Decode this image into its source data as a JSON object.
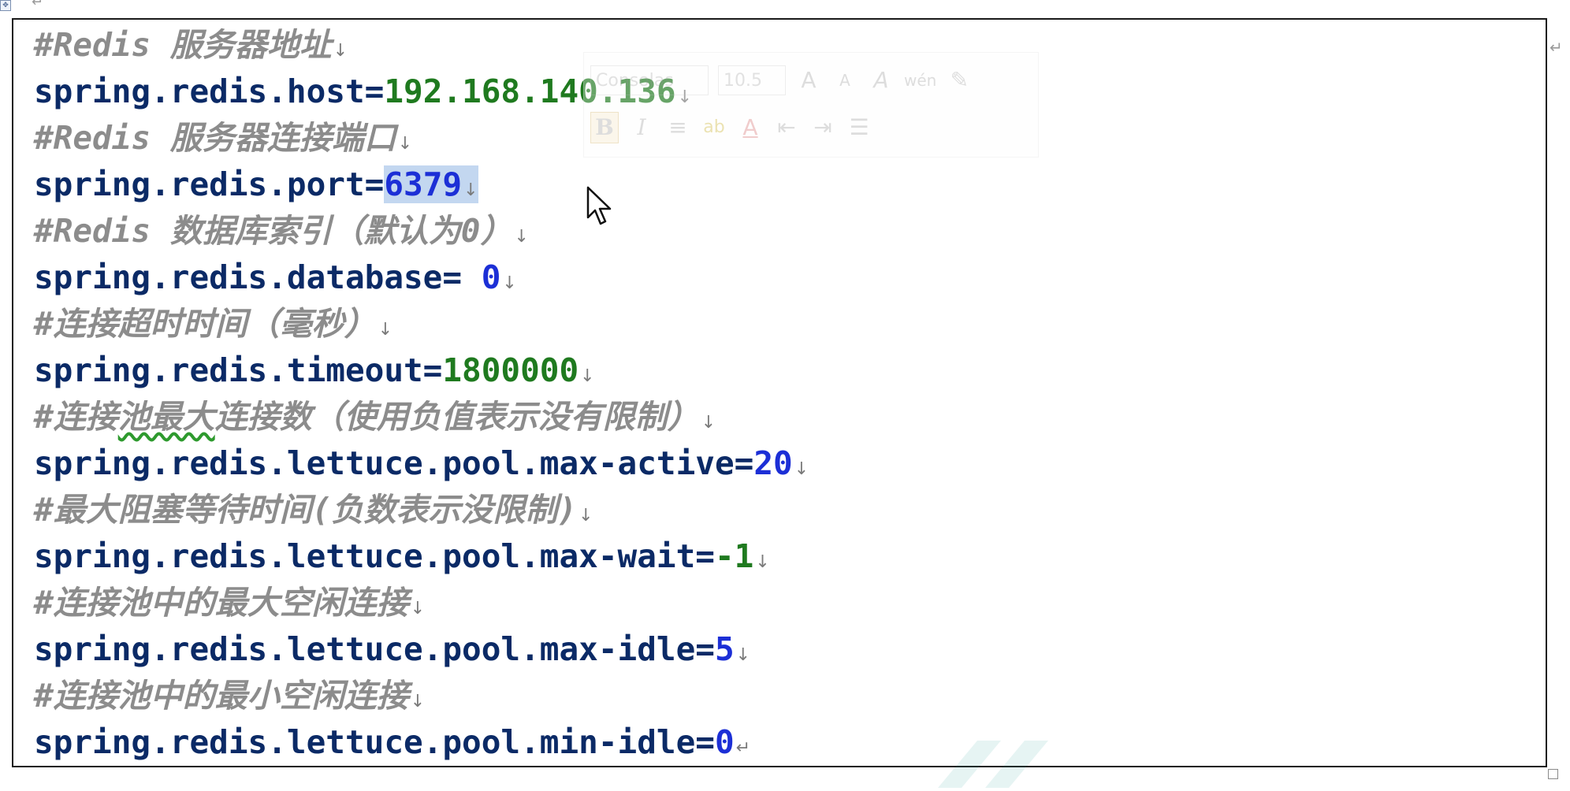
{
  "code_lines": [
    {
      "type": "comment",
      "text": "#Redis 服务器地址",
      "mark": "↓"
    },
    {
      "type": "kv",
      "key": "spring.redis.host=",
      "value": "192.168.140.136",
      "value_color": "green",
      "mark": "↓"
    },
    {
      "type": "comment",
      "text": "#Redis 服务器连接端口",
      "mark": "↓"
    },
    {
      "type": "kv",
      "key": "spring.redis.port=",
      "value": "6379",
      "value_color": "blue",
      "selected": true,
      "mark": "↓"
    },
    {
      "type": "comment",
      "text": "#Redis 数据库索引（默认为0）",
      "mark": "↓"
    },
    {
      "type": "kv",
      "key": "spring.redis.database= ",
      "value": "0",
      "value_color": "blue",
      "mark": "↓"
    },
    {
      "type": "comment",
      "text": "#连接超时时间（毫秒）",
      "mark": "↓"
    },
    {
      "type": "kv",
      "key": "spring.redis.timeout=",
      "value": "1800000",
      "value_color": "green",
      "mark": "↓"
    },
    {
      "type": "comment",
      "text_before": "#连接",
      "text_squiggle": "池最大",
      "text_after": "连接数（使用负值表示没有限制）",
      "mark": "↓"
    },
    {
      "type": "kv",
      "key": "spring.redis.lettuce.pool.max-active=",
      "value": "20",
      "value_color": "blue",
      "mark": "↓"
    },
    {
      "type": "comment",
      "text": "#最大阻塞等待时间(负数表示没限制)",
      "mark": "↓"
    },
    {
      "type": "kv",
      "key": "spring.redis.lettuce.pool.max-wait=",
      "value": "-1",
      "value_color": "green",
      "mark": "↓"
    },
    {
      "type": "comment",
      "text": "#连接池中的最大空闲连接",
      "mark": "↓"
    },
    {
      "type": "kv",
      "key": "spring.redis.lettuce.pool.max-idle=",
      "value": "5",
      "value_color": "blue",
      "mark": "↓"
    },
    {
      "type": "comment",
      "text": "#连接池中的最小空闲连接",
      "mark": "↓"
    },
    {
      "type": "kv",
      "key": "spring.redis.lettuce.pool.min-idle=",
      "value": "0",
      "value_color": "blue",
      "mark": "↵"
    }
  ],
  "paragraph_marks": {
    "top": "↵",
    "right": "↵"
  },
  "mini_toolbar": {
    "font_name": "Consolas",
    "font_size": "10.5",
    "grow_font": "A",
    "shrink_font": "A",
    "clear_format": "A",
    "phonetic": "wén",
    "bold": "B",
    "italic": "I",
    "center": "≡",
    "highlight": "ab",
    "font_color": "A",
    "decrease_indent": "⇤",
    "increase_indent": "⇥",
    "bullets": "☰"
  },
  "colors": {
    "comment": "#8c8c8c",
    "key": "#0b2a66",
    "value_green": "#1f7a1f",
    "value_blue": "#1c2fd6",
    "selection": "#c3d7f0"
  },
  "icons": {
    "anchor": "anchor-icon",
    "cursor": "mouse-pointer-icon"
  }
}
